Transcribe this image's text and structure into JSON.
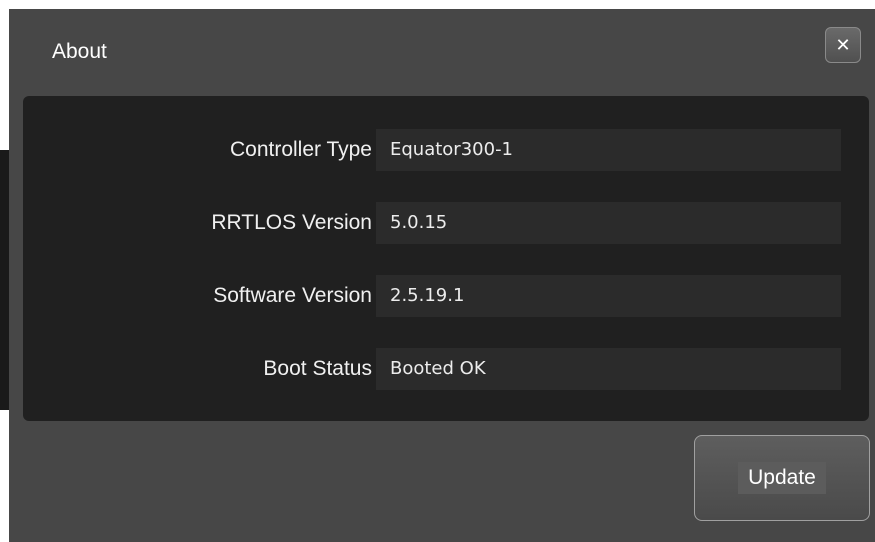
{
  "dialog": {
    "title": "About",
    "close_glyph": "✕",
    "close_icon": "close-icon"
  },
  "fields": [
    {
      "label": "Controller Type",
      "value": "Equator300-1"
    },
    {
      "label": "RRTLOS Version",
      "value": "5.0.15"
    },
    {
      "label": "Software Version",
      "value": "2.5.19.1"
    },
    {
      "label": "Boot Status",
      "value": "Booted OK"
    }
  ],
  "actions": {
    "update_label": "Update"
  },
  "colors": {
    "dialog_bg": "#474747",
    "panel_bg": "#202020",
    "field_bg": "#2b2b2b",
    "text": "#ffffff"
  }
}
